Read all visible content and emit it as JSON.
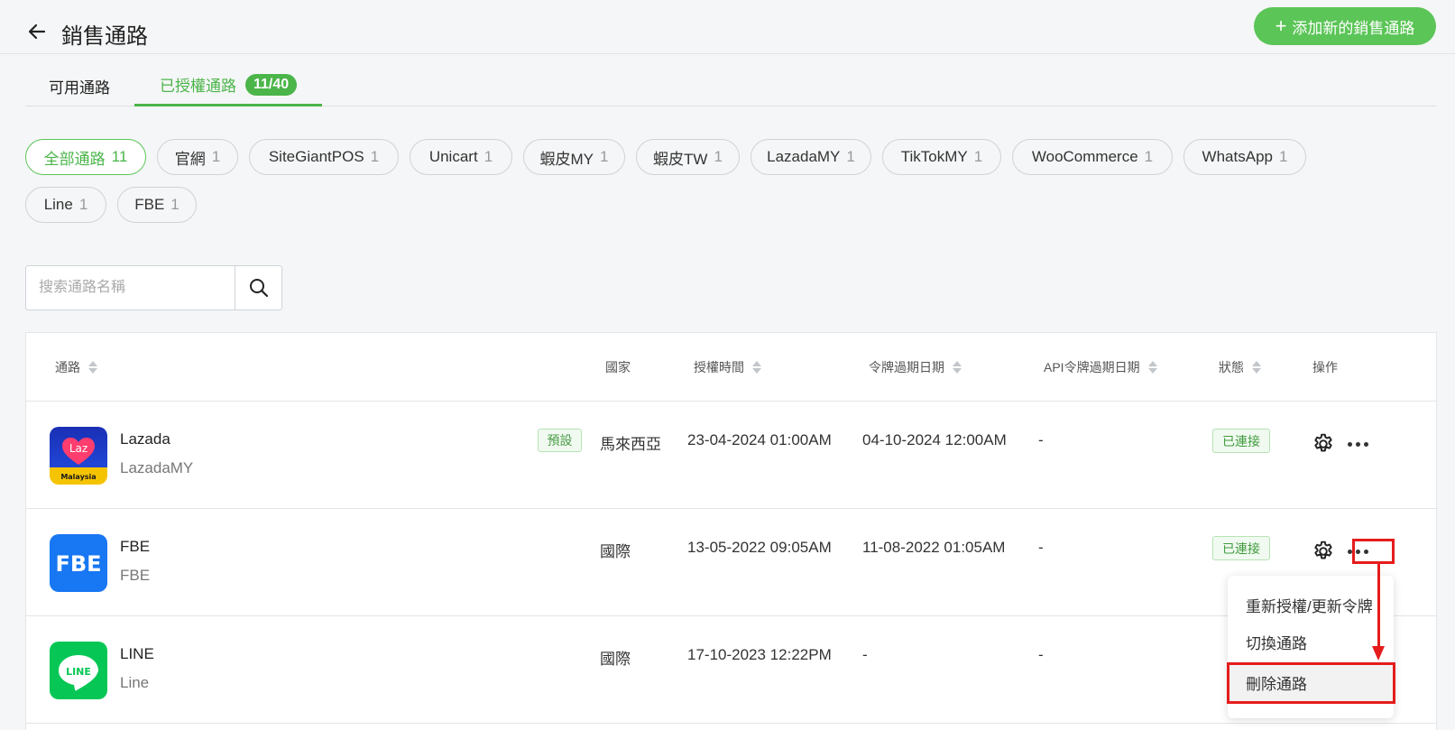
{
  "header": {
    "title": "銷售通路",
    "add_button_label": "添加新的銷售通路"
  },
  "tabs": {
    "available": "可用通路",
    "authorized": "已授權通路",
    "authorized_badge": "11/40"
  },
  "filters": [
    {
      "label": "全部通路",
      "count": "11",
      "active": true
    },
    {
      "label": "官網",
      "count": "1"
    },
    {
      "label": "SiteGiantPOS",
      "count": "1"
    },
    {
      "label": "Unicart",
      "count": "1"
    },
    {
      "label": "蝦皮MY",
      "count": "1"
    },
    {
      "label": "蝦皮TW",
      "count": "1"
    },
    {
      "label": "LazadaMY",
      "count": "1"
    },
    {
      "label": "TikTokMY",
      "count": "1"
    },
    {
      "label": "WooCommerce",
      "count": "1"
    },
    {
      "label": "WhatsApp",
      "count": "1"
    },
    {
      "label": "Line",
      "count": "1"
    },
    {
      "label": "FBE",
      "count": "1"
    }
  ],
  "search": {
    "placeholder": "搜索通路名稱"
  },
  "table": {
    "columns": {
      "channel": "通路",
      "country": "國家",
      "auth_time": "授權時間",
      "token_expiry": "令牌過期日期",
      "api_token_expiry": "API令牌過期日期",
      "status": "狀態",
      "actions": "操作"
    },
    "rows": [
      {
        "name": "Lazada",
        "sub": "LazadaMY",
        "logo_text": "Laz",
        "logo_caption": "Malaysia",
        "default_tag": "預設",
        "country": "馬來西亞",
        "auth_time": "23-04-2024 01:00AM",
        "token_expiry": "04-10-2024 12:00AM",
        "api_token_expiry": "-",
        "status": "已連接"
      },
      {
        "name": "FBE",
        "sub": "FBE",
        "logo_text": "FBE",
        "country": "國際",
        "auth_time": "13-05-2022 09:05AM",
        "token_expiry": "11-08-2022 01:05AM",
        "api_token_expiry": "-",
        "status": "已連接"
      },
      {
        "name": "LINE",
        "sub": "Line",
        "logo_text": "LINE",
        "country": "國際",
        "auth_time": "17-10-2023 12:22PM",
        "token_expiry": "-",
        "api_token_expiry": "-"
      }
    ]
  },
  "action_menu": {
    "items": [
      "重新授權/更新令牌",
      "切換通路",
      "刪除通路"
    ]
  },
  "colors": {
    "brand_green": "#5bc557",
    "highlight_red": "#e51c1c",
    "fbe_blue": "#1877f2",
    "line_green": "#06c755"
  }
}
